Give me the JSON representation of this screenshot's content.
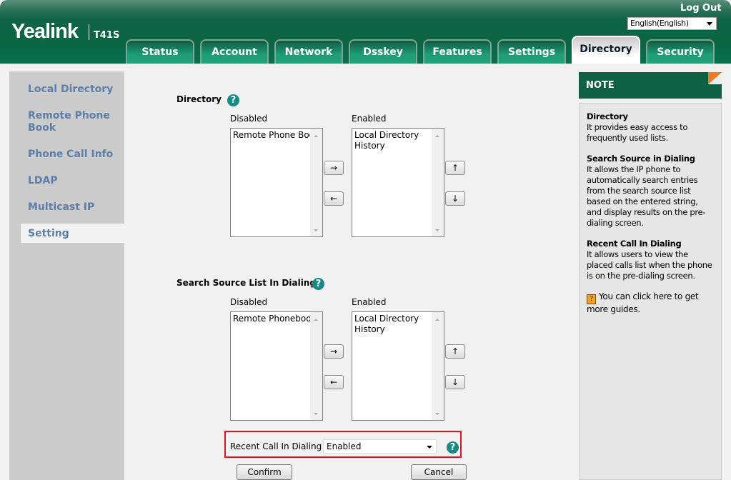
{
  "header": {
    "logo": "Yealink",
    "model": "T41S",
    "logout": "Log Out",
    "language": "English(English)"
  },
  "tabs": [
    {
      "label": "Status"
    },
    {
      "label": "Account"
    },
    {
      "label": "Network"
    },
    {
      "label": "Dsskey"
    },
    {
      "label": "Features"
    },
    {
      "label": "Settings"
    },
    {
      "label": "Directory",
      "active": true
    },
    {
      "label": "Security"
    }
  ],
  "sidebar": {
    "items": [
      {
        "label": "Local Directory"
      },
      {
        "label": "Remote Phone Book"
      },
      {
        "label": "Phone Call Info"
      },
      {
        "label": "LDAP"
      },
      {
        "label": "Multicast IP"
      },
      {
        "label": "Setting",
        "active": true
      }
    ]
  },
  "directory": {
    "title": "Directory",
    "disabled_label": "Disabled",
    "enabled_label": "Enabled",
    "disabled_items": [
      "Remote Phone Book"
    ],
    "enabled_items": [
      "Local Directory",
      "History"
    ]
  },
  "search_source": {
    "title": "Search Source List In Dialing",
    "disabled_label": "Disabled",
    "enabled_label": "Enabled",
    "disabled_items": [
      "Remote Phonebook"
    ],
    "enabled_items": [
      "Local Directory",
      "History"
    ]
  },
  "arrows": {
    "right": "→",
    "left": "←",
    "up": "↑",
    "down": "↓"
  },
  "help": "?",
  "recent_call": {
    "label": "Recent Call In Dialing",
    "value": "Enabled"
  },
  "buttons": {
    "confirm": "Confirm",
    "cancel": "Cancel"
  },
  "note": {
    "title": "NOTE",
    "sections": [
      {
        "heading": "Directory",
        "text": "It provides easy access to frequently used lists."
      },
      {
        "heading": "Search Source in Dialing",
        "text": "It allows the IP phone to automatically search entries from the search source list based on the entered string, and display results on the pre-dialing screen."
      },
      {
        "heading": "Recent Call In Dialing",
        "text": "It allows users to view the placed calls list when the phone is on the pre-dialing screen."
      }
    ],
    "guide_icon": "?",
    "guide": "You can click here to get more guides."
  },
  "colors": {
    "header_green": "#0b6646",
    "sidebar_link": "#5b7fa9",
    "note_corner": "#f47a20",
    "highlight_border": "#e0141e",
    "help_icon": "#138a86"
  }
}
